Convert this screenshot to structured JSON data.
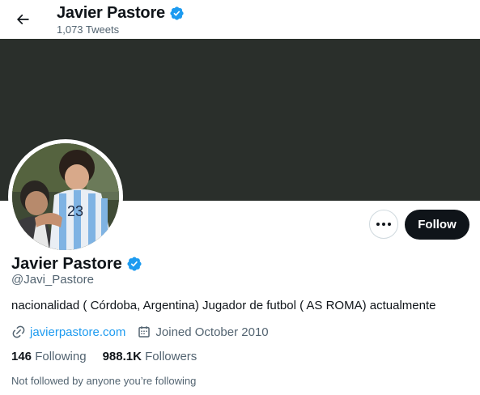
{
  "header": {
    "title": "Javier Pastore",
    "tweet_count": "1,073 Tweets"
  },
  "profile": {
    "name": "Javier Pastore",
    "handle": "@Javi_Pastore",
    "bio": "nacionalidad ( Córdoba, Argentina) Jugador de futbol ( AS ROMA) actualmente",
    "website": "javierpastore.com",
    "joined": "Joined October 2010",
    "following_count": "146",
    "following_label": "Following",
    "followers_count": "988.1K",
    "followers_label": "Followers",
    "mutuals_note": "Not followed by anyone you’re following",
    "avatar_jersey_number": "23"
  },
  "actions": {
    "follow_label": "Follow"
  },
  "icons": {
    "back": "arrow-left-icon",
    "verified": "verified-badge-icon",
    "more": "more-horizontal-icon",
    "link": "link-icon",
    "calendar": "calendar-icon"
  },
  "colors": {
    "accent": "#1d9bf0",
    "banner": "#2a2f2b",
    "primary_text": "#0f1419",
    "secondary_text": "#536471",
    "follow_button": "#0f1419"
  }
}
